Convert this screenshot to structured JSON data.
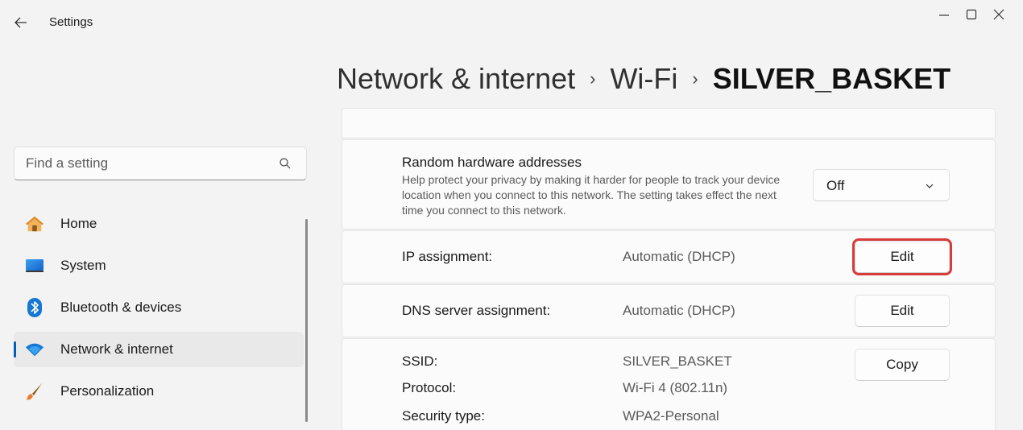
{
  "window": {
    "app_title": "Settings"
  },
  "breadcrumb": {
    "items": [
      "Network & internet",
      "Wi-Fi",
      "SILVER_BASKET"
    ]
  },
  "search": {
    "placeholder": "Find a setting"
  },
  "nav": {
    "items": [
      {
        "label": "Home"
      },
      {
        "label": "System"
      },
      {
        "label": "Bluetooth & devices"
      },
      {
        "label": "Network & internet"
      },
      {
        "label": "Personalization"
      }
    ]
  },
  "random_hw": {
    "title": "Random hardware addresses",
    "description": "Help protect your privacy by making it harder for people to track your device location when you connect to this network. The setting takes effect the next time you connect to this network.",
    "value": "Off"
  },
  "ip_assignment": {
    "label": "IP assignment:",
    "value": "Automatic (DHCP)",
    "button": "Edit"
  },
  "dns_assignment": {
    "label": "DNS server assignment:",
    "value": "Automatic (DHCP)",
    "button": "Edit"
  },
  "properties": {
    "copy_button": "Copy",
    "ssid": {
      "label": "SSID:",
      "value": "SILVER_BASKET"
    },
    "protocol": {
      "label": "Protocol:",
      "value": "Wi-Fi 4 (802.11n)"
    },
    "security": {
      "label": "Security type:",
      "value": "WPA2-Personal"
    }
  },
  "colors": {
    "accent": "#005fb8",
    "highlight_outline": "#d93b3b",
    "background": "#f3f3f3",
    "card": "#fbfbfb"
  }
}
